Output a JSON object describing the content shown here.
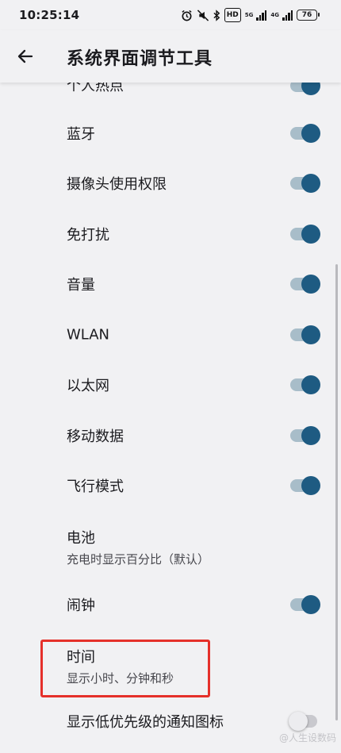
{
  "status_bar": {
    "time": "10:25:14",
    "hd": "HD",
    "net1": "5G",
    "net2": "4G",
    "battery": "76"
  },
  "header": {
    "title": "系统界面调节工具"
  },
  "items": [
    {
      "label": "个人热点",
      "on": true
    },
    {
      "label": "蓝牙",
      "on": true
    },
    {
      "label": "摄像头使用权限",
      "on": true
    },
    {
      "label": "免打扰",
      "on": true
    },
    {
      "label": "音量",
      "on": true
    },
    {
      "label": "WLAN",
      "on": true
    },
    {
      "label": "以太网",
      "on": true
    },
    {
      "label": "移动数据",
      "on": true
    },
    {
      "label": "飞行模式",
      "on": true
    },
    {
      "label": "电池",
      "sub": "充电时显示百分比（默认）"
    },
    {
      "label": "闹钟",
      "on": true
    },
    {
      "label": "时间",
      "sub": "显示小时、分钟和秒"
    },
    {
      "label": "显示低优先级的通知图标",
      "on": false
    }
  ],
  "watermark": "@人生设数码",
  "colors": {
    "toggle_thumb_on": "#1e5b82",
    "toggle_track_on": "#a8bdc9",
    "highlight": "#e5302a",
    "background": "#f1f1f3"
  }
}
